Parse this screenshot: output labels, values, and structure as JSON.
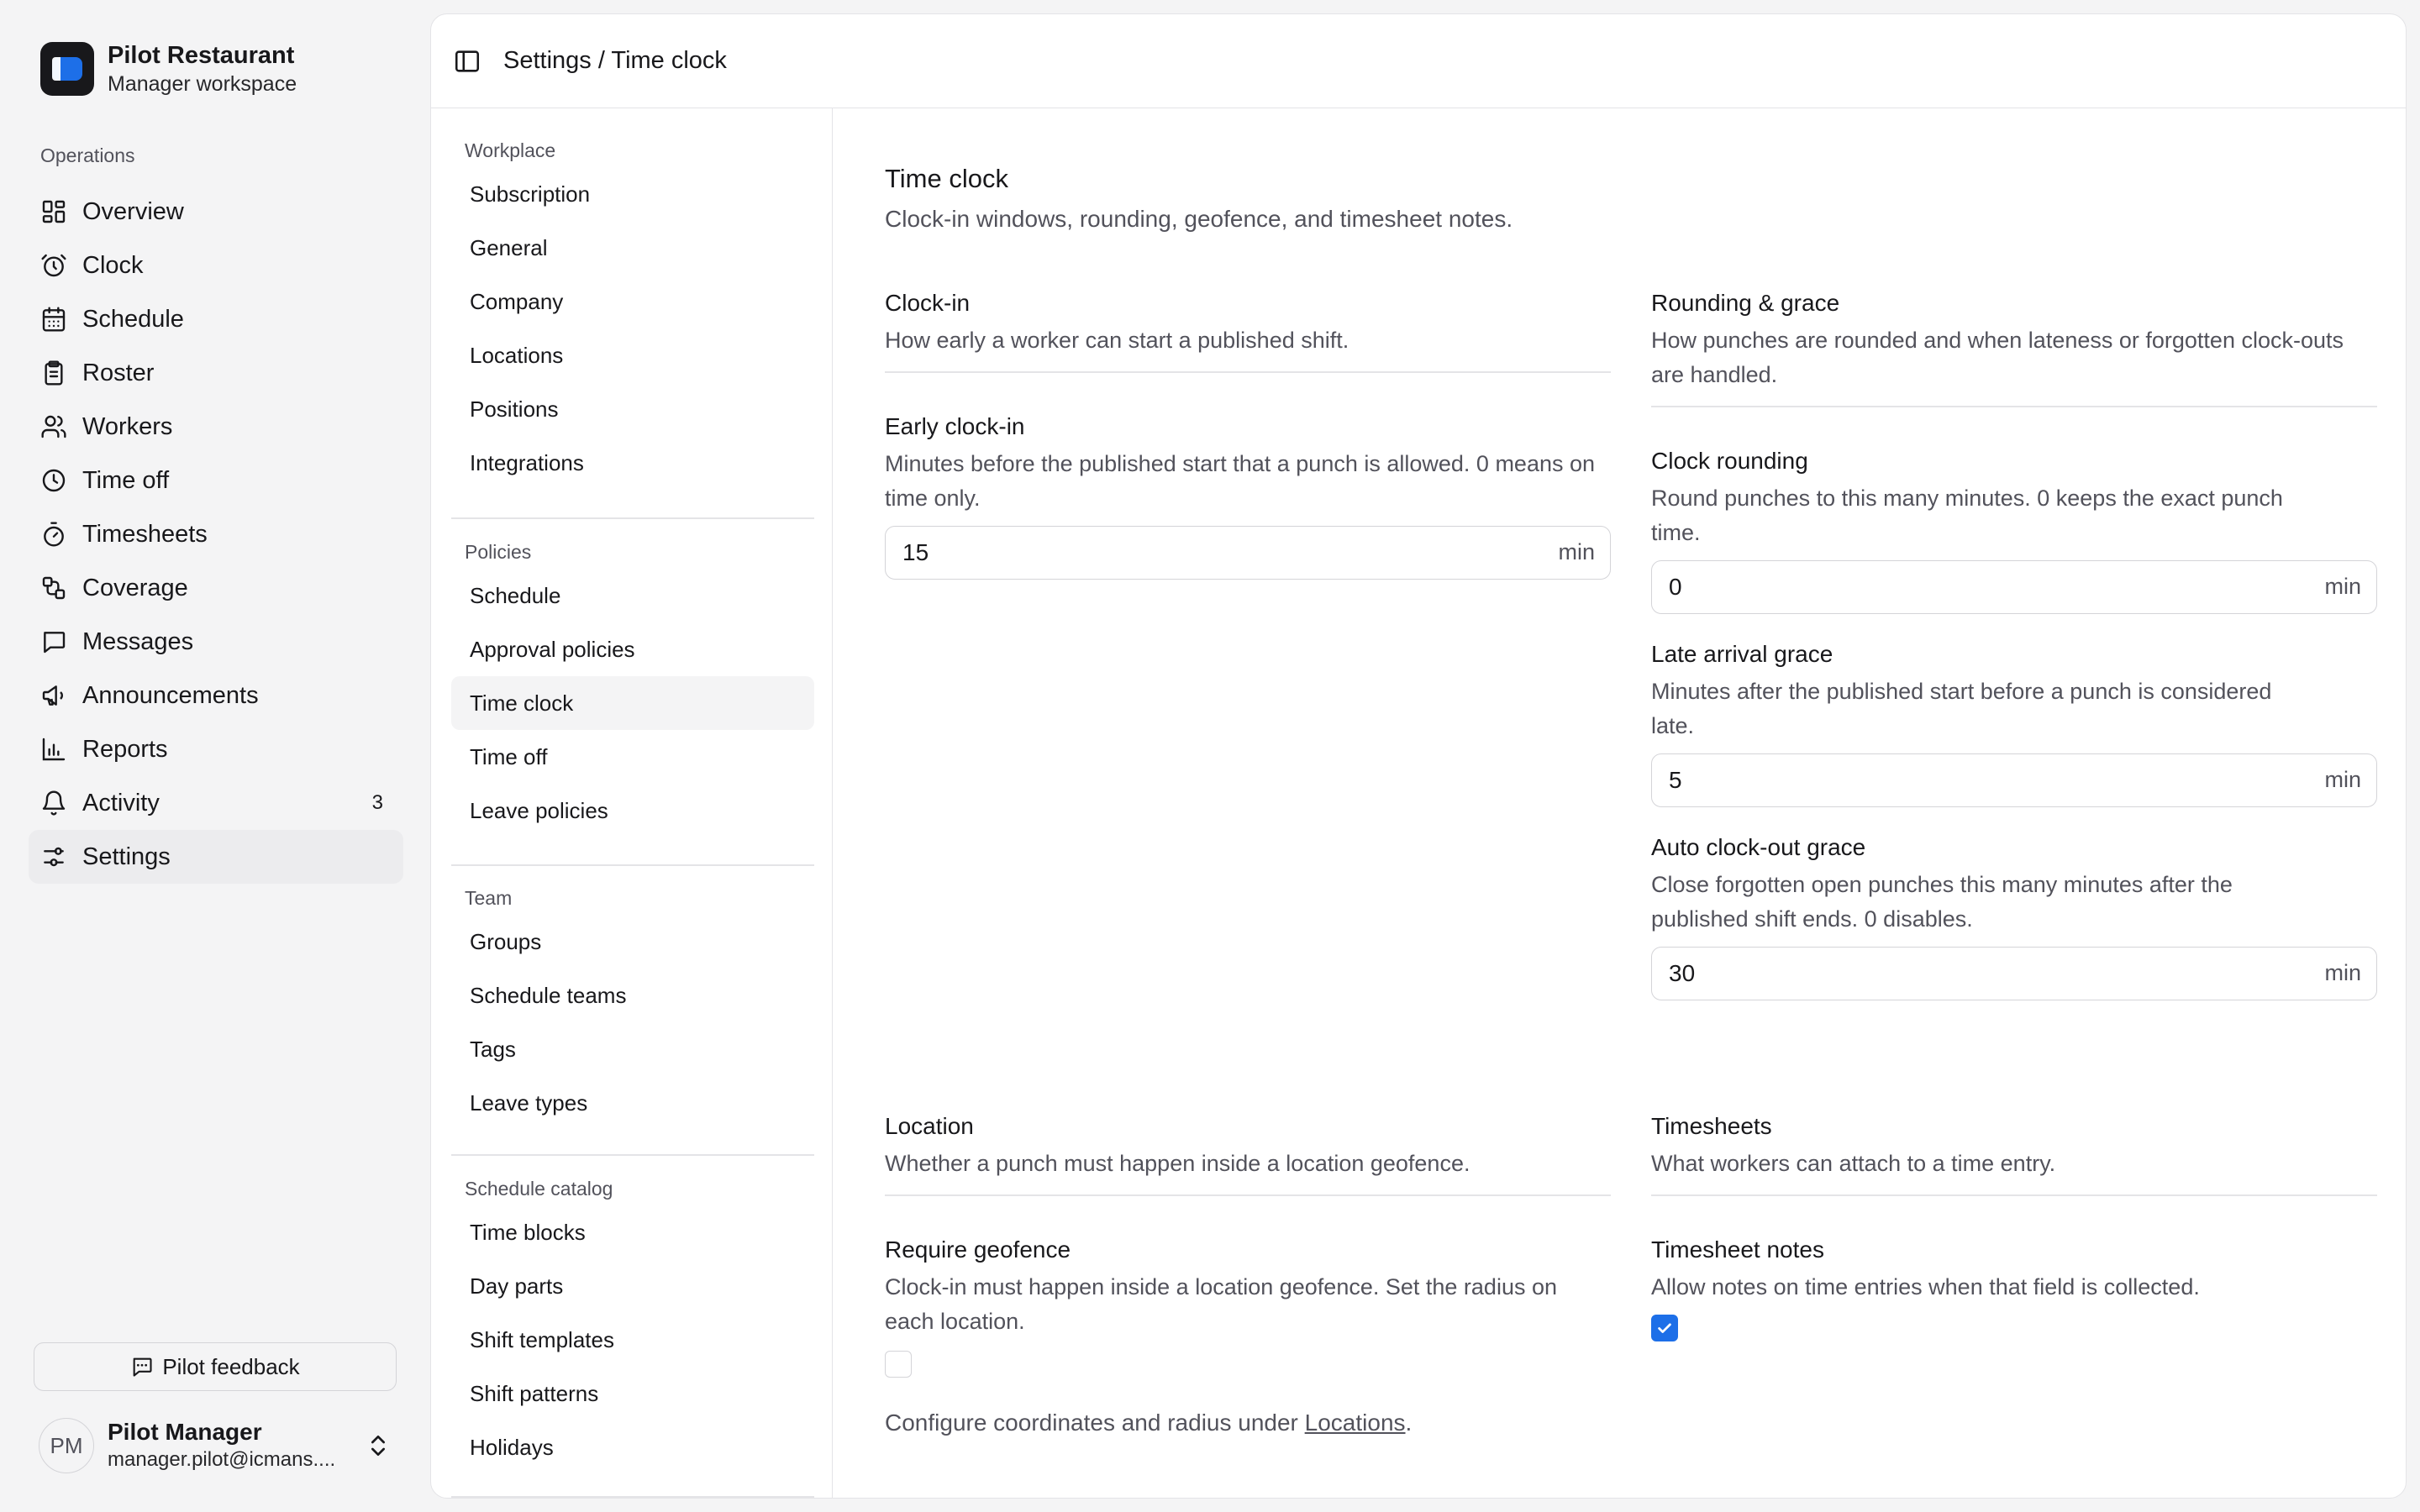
{
  "brand": {
    "name": "Pilot Restaurant",
    "subtitle": "Manager workspace"
  },
  "sidebar": {
    "group_label": "Operations",
    "items": [
      {
        "label": "Overview",
        "icon": "grid-icon"
      },
      {
        "label": "Clock",
        "icon": "alarm-clock-icon"
      },
      {
        "label": "Schedule",
        "icon": "calendar-icon"
      },
      {
        "label": "Roster",
        "icon": "clipboard-icon"
      },
      {
        "label": "Workers",
        "icon": "users-icon"
      },
      {
        "label": "Time off",
        "icon": "clock-icon"
      },
      {
        "label": "Timesheets",
        "icon": "stopwatch-icon"
      },
      {
        "label": "Coverage",
        "icon": "route-icon"
      },
      {
        "label": "Messages",
        "icon": "message-icon"
      },
      {
        "label": "Announcements",
        "icon": "megaphone-icon"
      },
      {
        "label": "Reports",
        "icon": "bar-chart-icon"
      },
      {
        "label": "Activity",
        "icon": "bell-icon",
        "count": "3"
      },
      {
        "label": "Settings",
        "icon": "sliders-icon",
        "active": true
      }
    ],
    "feedback_label": "Pilot feedback",
    "user": {
      "initials": "PM",
      "name": "Pilot Manager",
      "email": "manager.pilot@icmans...."
    }
  },
  "topbar": {
    "breadcrumb": "Settings / Time clock"
  },
  "settings_nav": {
    "sections": [
      {
        "label": "Workplace",
        "items": [
          "Subscription",
          "General",
          "Company",
          "Locations",
          "Positions",
          "Integrations"
        ]
      },
      {
        "label": "Policies",
        "items": [
          "Schedule",
          "Approval policies",
          "Time clock",
          "Time off",
          "Leave policies"
        ]
      },
      {
        "label": "Team",
        "items": [
          "Groups",
          "Schedule teams",
          "Tags",
          "Leave types"
        ]
      },
      {
        "label": "Schedule catalog",
        "items": [
          "Time blocks",
          "Day parts",
          "Shift templates",
          "Shift patterns",
          "Holidays"
        ]
      }
    ],
    "active_item": "Time clock"
  },
  "page": {
    "title": "Time clock",
    "description": "Clock-in windows, rounding, geofence, and timesheet notes.",
    "clock_in": {
      "title": "Clock-in",
      "description": "How early a worker can start a published shift.",
      "early": {
        "title": "Early clock-in",
        "description": "Minutes before the published start that a punch is allowed. 0 means on time only.",
        "value": "15",
        "unit": "min"
      }
    },
    "rounding": {
      "title": "Rounding & grace",
      "description": "How punches are rounded and when lateness or forgotten clock-outs are handled.",
      "clock_rounding": {
        "title": "Clock rounding",
        "description": "Round punches to this many minutes. 0 keeps the exact punch time.",
        "value": "0",
        "unit": "min"
      },
      "late_grace": {
        "title": "Late arrival grace",
        "description": "Minutes after the published start before a punch is considered late.",
        "value": "5",
        "unit": "min"
      },
      "auto_out": {
        "title": "Auto clock-out grace",
        "description": "Close forgotten open punches this many minutes after the published shift ends. 0 disables.",
        "value": "30",
        "unit": "min"
      }
    },
    "location": {
      "title": "Location",
      "description": "Whether a punch must happen inside a location geofence.",
      "geofence": {
        "title": "Require geofence",
        "description": "Clock-in must happen inside a location geofence. Set the radius on each location.",
        "checked": false
      },
      "note_prefix": "Configure coordinates and radius under ",
      "note_link": "Locations",
      "note_suffix": "."
    },
    "timesheets": {
      "title": "Timesheets",
      "description": "What workers can attach to a time entry.",
      "notes": {
        "title": "Timesheet notes",
        "description": "Allow notes on time entries when that field is collected.",
        "checked": true
      }
    }
  },
  "colors": {
    "accent": "#1d6fe8",
    "border": "#e4e4e7",
    "muted_text": "#52525b"
  }
}
